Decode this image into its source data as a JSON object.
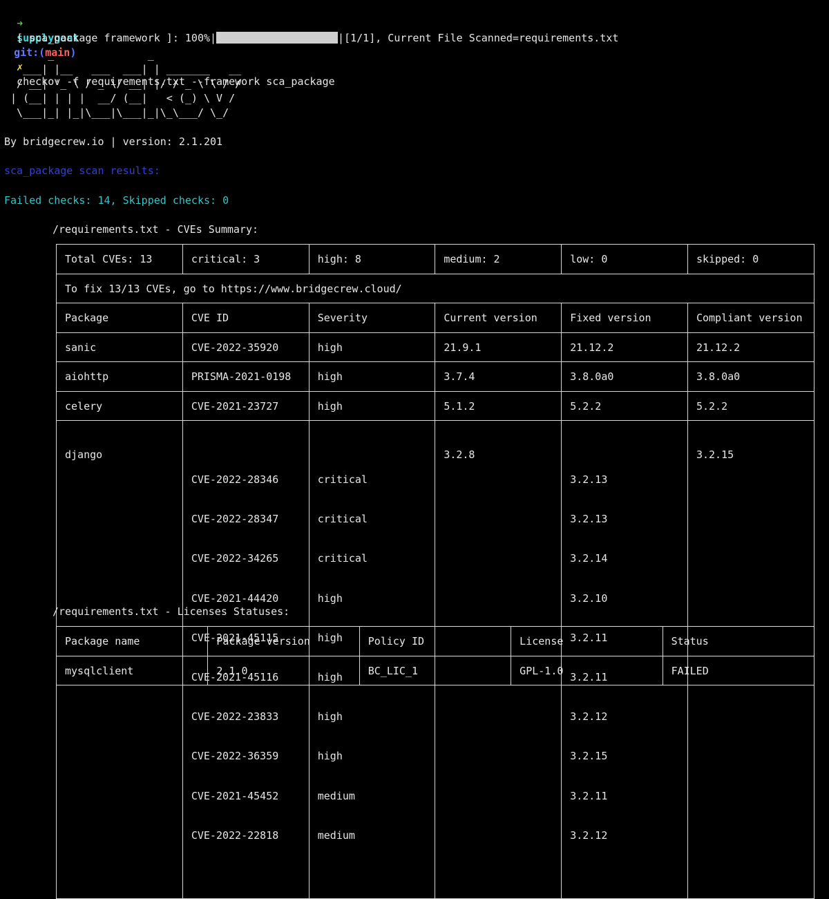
{
  "prompt": {
    "arrow": "➜",
    "directory": "supplygoat",
    "git_label": "git:(",
    "branch": "main",
    "git_close": ")",
    "dirty_mark": "✗",
    "command": "checkov -f requirements.txt --framework sca_package"
  },
  "progress": {
    "prefix": "[ sca_package framework ]: 100%|",
    "fraction": 1.0,
    "suffix": "|[1/1], Current File Scanned=requirements.txt"
  },
  "banner": "       _               _\n   ___| |__   ___  ___| | _______   __\n  / __| '_ \\ / _ \\/ __| |/ / _ \\ \\ / /\n | (__| | | |  __/ (__|   < (_) \\ V /\n  \\___|_| |_|\\___|\\___|_|\\_\\___/ \\_/",
  "byline": "By bridgecrew.io | version: 2.1.201",
  "scan_results_title": "sca_package scan results:",
  "checks_summary": "Failed checks: 14, Skipped checks: 0",
  "cve_section": {
    "heading": "/requirements.txt - CVEs Summary:",
    "summary": [
      "Total CVEs: 13",
      "critical: 3",
      "high: 8",
      "medium: 2",
      "low: 0",
      "skipped: 0"
    ],
    "fix_note": "To fix 13/13 CVEs, go to https://www.bridgecrew.cloud/",
    "headers": [
      "Package",
      "CVE ID",
      "Severity",
      "Current version",
      "Fixed version",
      "Compliant version"
    ],
    "rows": [
      {
        "package": "sanic",
        "cve_ids": [
          "CVE-2022-35920"
        ],
        "severities": [
          "high"
        ],
        "current": "21.9.1",
        "fixed": [
          "21.12.2"
        ],
        "compliant": "21.12.2"
      },
      {
        "package": "aiohttp",
        "cve_ids": [
          "PRISMA-2021-0198"
        ],
        "severities": [
          "high"
        ],
        "current": "3.7.4",
        "fixed": [
          "3.8.0a0"
        ],
        "compliant": "3.8.0a0"
      },
      {
        "package": "celery",
        "cve_ids": [
          "CVE-2021-23727"
        ],
        "severities": [
          "high"
        ],
        "current": "5.1.2",
        "fixed": [
          "5.2.2"
        ],
        "compliant": "5.2.2"
      },
      {
        "package": "django",
        "cve_ids": [
          "CVE-2022-28346",
          "CVE-2022-28347",
          "CVE-2022-34265",
          "CVE-2021-44420",
          "CVE-2021-45115",
          "CVE-2021-45116",
          "CVE-2022-23833",
          "CVE-2022-36359",
          "CVE-2021-45452",
          "CVE-2022-22818"
        ],
        "severities": [
          "critical",
          "critical",
          "critical",
          "high",
          "high",
          "high",
          "high",
          "high",
          "medium",
          "medium"
        ],
        "current": "3.2.8",
        "fixed": [
          "3.2.13",
          "3.2.13",
          "3.2.14",
          "3.2.10",
          "3.2.11",
          "3.2.11",
          "3.2.12",
          "3.2.15",
          "3.2.11",
          "3.2.12"
        ],
        "compliant": "3.2.15"
      }
    ]
  },
  "license_section": {
    "heading": "/requirements.txt - Licenses Statuses:",
    "headers": [
      "Package name",
      "Package version",
      "Policy ID",
      "License",
      "Status"
    ],
    "rows": [
      {
        "package_name": "mysqlclient",
        "package_version": "2.1.0",
        "policy_id": "BC_LIC_1",
        "license": "GPL-1.0",
        "status": "FAILED"
      }
    ]
  },
  "colors": {
    "background": "#000000",
    "text": "#e6e6e6",
    "prompt_arrow": "#3fd13f",
    "directory": "#3ad7dd",
    "git_label": "#5d79ff",
    "branch": "#ff5e5e",
    "dirty_mark": "#f4e04b",
    "scan_title": "#2f3fd8",
    "checks_summary": "#32c4c9",
    "table_border": "#d8d8d8"
  }
}
